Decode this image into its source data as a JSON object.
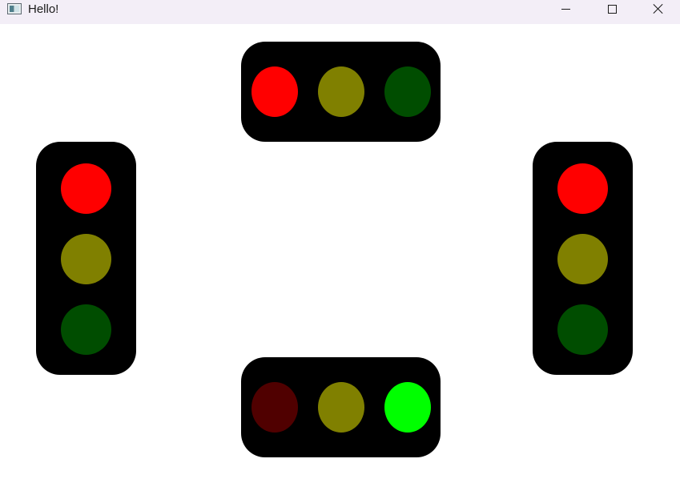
{
  "window": {
    "title": "Hello!",
    "controls": [
      "minimize",
      "maximize",
      "close"
    ]
  },
  "colors": {
    "red_on": "#ff0000",
    "red_dim": "#500000",
    "yellow_dim": "#808000",
    "green_dim": "#004d00",
    "green_on": "#00ff00",
    "housing": "#000000"
  },
  "traffic_lights": {
    "top": {
      "orientation": "horizontal",
      "lamps": [
        "red_on",
        "yellow_dim",
        "green_dim"
      ]
    },
    "left": {
      "orientation": "vertical",
      "lamps": [
        "red_on",
        "yellow_dim",
        "green_dim"
      ]
    },
    "right": {
      "orientation": "vertical",
      "lamps": [
        "red_on",
        "yellow_dim",
        "green_dim"
      ]
    },
    "bottom": {
      "orientation": "horizontal",
      "lamps": [
        "red_dim",
        "yellow_dim",
        "green_on"
      ]
    }
  }
}
